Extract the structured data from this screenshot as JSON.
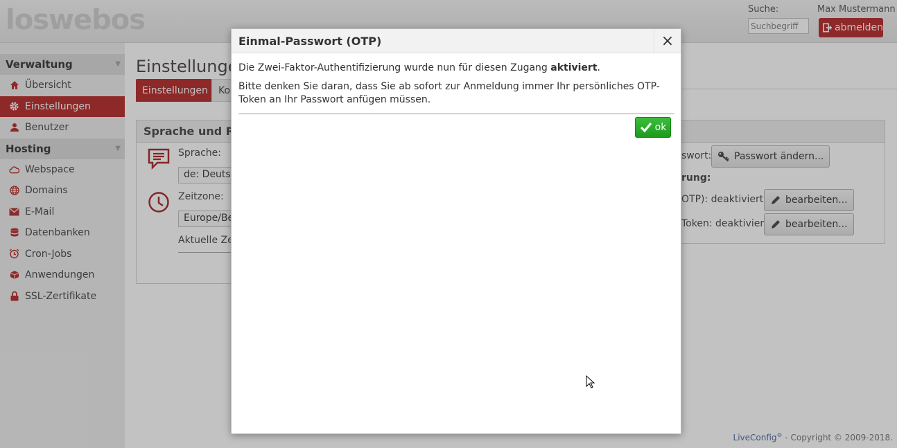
{
  "header": {
    "logo": "loswebos",
    "search_label": "Suche:",
    "search_placeholder": "Suchbegriff",
    "user_name": "Max Mustermann",
    "logout_label": "abmelden"
  },
  "sidebar": {
    "sections": [
      {
        "title": "Verwaltung",
        "items": [
          {
            "label": "Übersicht",
            "icon": "home-icon"
          },
          {
            "label": "Einstellungen",
            "icon": "gear-icon",
            "active": true
          },
          {
            "label": "Benutzer",
            "icon": "user-icon"
          }
        ]
      },
      {
        "title": "Hosting",
        "items": [
          {
            "label": "Webspace",
            "icon": "cloud-icon"
          },
          {
            "label": "Domains",
            "icon": "globe-icon"
          },
          {
            "label": "E-Mail",
            "icon": "mail-icon"
          },
          {
            "label": "Datenbanken",
            "icon": "database-icon"
          },
          {
            "label": "Cron-Jobs",
            "icon": "alarm-clock-icon"
          },
          {
            "label": "Anwendungen",
            "icon": "package-icon"
          },
          {
            "label": "SSL-Zertifikate",
            "icon": "lock-icon"
          }
        ]
      }
    ]
  },
  "main": {
    "title": "Einstellungen",
    "tabs": [
      "Einstellungen",
      "Ko"
    ],
    "left_panel": {
      "title": "Sprache und Re",
      "language_label": "Sprache:",
      "language_value": "de: Deutsc",
      "timezone_label": "Zeitzone:",
      "timezone_value": "Europe/Be",
      "current_time_label": "Aktuelle Ze"
    },
    "right_panel": {
      "password_label": "swort:",
      "password_button": "Passwort ändern...",
      "section_label": "rung:",
      "otp_label": "OTP): deaktiviert",
      "otp_button": "bearbeiten...",
      "token_label": "Token: deaktiviert",
      "token_button": "bearbeiten..."
    }
  },
  "dialog": {
    "title": "Einmal-Passwort (OTP)",
    "close": "×",
    "line1_prefix": "Die Zwei-Faktor-Authentifizierung wurde nun für diesen Zugang ",
    "line1_bold": "aktiviert",
    "line1_suffix": ".",
    "line2": "Bitte denken Sie daran, dass Sie ab sofort zur Anmeldung immer Ihr persönliches OTP-Token an Ihr Passwort anfügen müssen.",
    "ok_label": "ok"
  },
  "footer": {
    "brand": "LiveConfig",
    "sup": "®",
    "text": " - Copyright © 2009-2018."
  },
  "colors": {
    "brand_red": "#b01515",
    "ok_green": "#1e9a1e"
  }
}
